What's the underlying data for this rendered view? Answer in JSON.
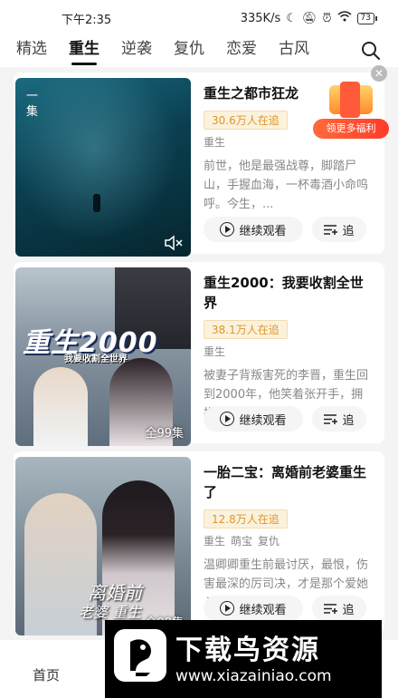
{
  "status_bar": {
    "time": "下午2:35",
    "network_speed": "335K/s",
    "battery": "73"
  },
  "tabs": [
    {
      "label": "精选",
      "active": false
    },
    {
      "label": "重生",
      "active": true
    },
    {
      "label": "逆袭",
      "active": false
    },
    {
      "label": "复仇",
      "active": false
    },
    {
      "label": "恋爱",
      "active": false
    },
    {
      "label": "古风",
      "active": false
    }
  ],
  "cards": [
    {
      "poster_label": "一\n集",
      "title": "重生之都市狂龙",
      "views": "30.6万人在追",
      "tags": [
        "重生"
      ],
      "desc": "前世，他是最强战尊，脚踏尸山，手握血海，一杯毒酒小命呜呼。今生，...",
      "watch_label": "继续观看",
      "follow_label": "追",
      "colors": {
        "poster": "#0e4a5c"
      }
    },
    {
      "poster_label": "全99集",
      "title": "重生2000：我要收割全世界",
      "views": "38.1万人在追",
      "tags": [
        "重生"
      ],
      "desc": "被妻子背叛害死的李晋，重生回到2000年，他笑着张开手，拥抱这个属于...",
      "watch_label": "继续观看",
      "follow_label": "追",
      "colors": {
        "poster": "#6a7c8c"
      }
    },
    {
      "poster_label": "全99集",
      "title": "一胎二宝：离婚前老婆重生了",
      "views": "12.8万人在追",
      "tags": [
        "重生",
        "萌宝",
        "复仇"
      ],
      "desc": "温卿卿重生前最讨厌，最恨，伤害最深的厉司决，才是那个爱她入骨的人...",
      "watch_label": "继续观看",
      "follow_label": "追",
      "colors": {
        "poster": "#8a9aa8"
      }
    }
  ],
  "promo": {
    "label": "领更多福利"
  },
  "bottom_nav": {
    "home_label": "首页"
  },
  "watermark": {
    "title": "下载鸟资源",
    "url": "www.xiazainiao.com"
  }
}
